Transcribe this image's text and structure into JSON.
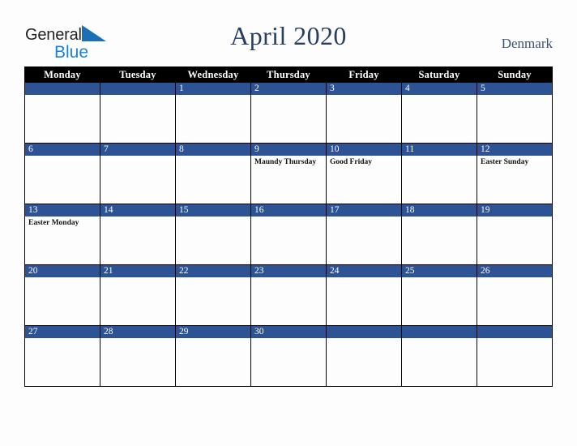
{
  "brand": {
    "name_part1": "General",
    "name_part2": "Blue",
    "triangle_color": "#1a6fb5",
    "blue_color": "#1a82d4"
  },
  "header": {
    "title": "April 2020",
    "country": "Denmark",
    "title_color": "#27405f",
    "country_color": "#3b5174"
  },
  "calendar": {
    "header_bg": "#000000",
    "header_fg": "#ffffff",
    "daybar_bg": "#2e5395",
    "daybar_fg": "#ffffff",
    "cell_bg": "#fdfdfd",
    "border_color": "#000000",
    "weekdays": [
      "Monday",
      "Tuesday",
      "Wednesday",
      "Thursday",
      "Friday",
      "Saturday",
      "Sunday"
    ],
    "weeks": [
      [
        {
          "day": "",
          "events": []
        },
        {
          "day": "",
          "events": []
        },
        {
          "day": "1",
          "events": []
        },
        {
          "day": "2",
          "events": []
        },
        {
          "day": "3",
          "events": []
        },
        {
          "day": "4",
          "events": []
        },
        {
          "day": "5",
          "events": []
        }
      ],
      [
        {
          "day": "6",
          "events": []
        },
        {
          "day": "7",
          "events": []
        },
        {
          "day": "8",
          "events": []
        },
        {
          "day": "9",
          "events": [
            "Maundy Thursday"
          ]
        },
        {
          "day": "10",
          "events": [
            "Good Friday"
          ]
        },
        {
          "day": "11",
          "events": []
        },
        {
          "day": "12",
          "events": [
            "Easter Sunday"
          ]
        }
      ],
      [
        {
          "day": "13",
          "events": [
            "Easter Monday"
          ]
        },
        {
          "day": "14",
          "events": []
        },
        {
          "day": "15",
          "events": []
        },
        {
          "day": "16",
          "events": []
        },
        {
          "day": "17",
          "events": []
        },
        {
          "day": "18",
          "events": []
        },
        {
          "day": "19",
          "events": []
        }
      ],
      [
        {
          "day": "20",
          "events": []
        },
        {
          "day": "21",
          "events": []
        },
        {
          "day": "22",
          "events": []
        },
        {
          "day": "23",
          "events": []
        },
        {
          "day": "24",
          "events": []
        },
        {
          "day": "25",
          "events": []
        },
        {
          "day": "26",
          "events": []
        }
      ],
      [
        {
          "day": "27",
          "events": []
        },
        {
          "day": "28",
          "events": []
        },
        {
          "day": "29",
          "events": []
        },
        {
          "day": "30",
          "events": []
        },
        {
          "day": "",
          "events": []
        },
        {
          "day": "",
          "events": []
        },
        {
          "day": "",
          "events": []
        }
      ]
    ]
  }
}
